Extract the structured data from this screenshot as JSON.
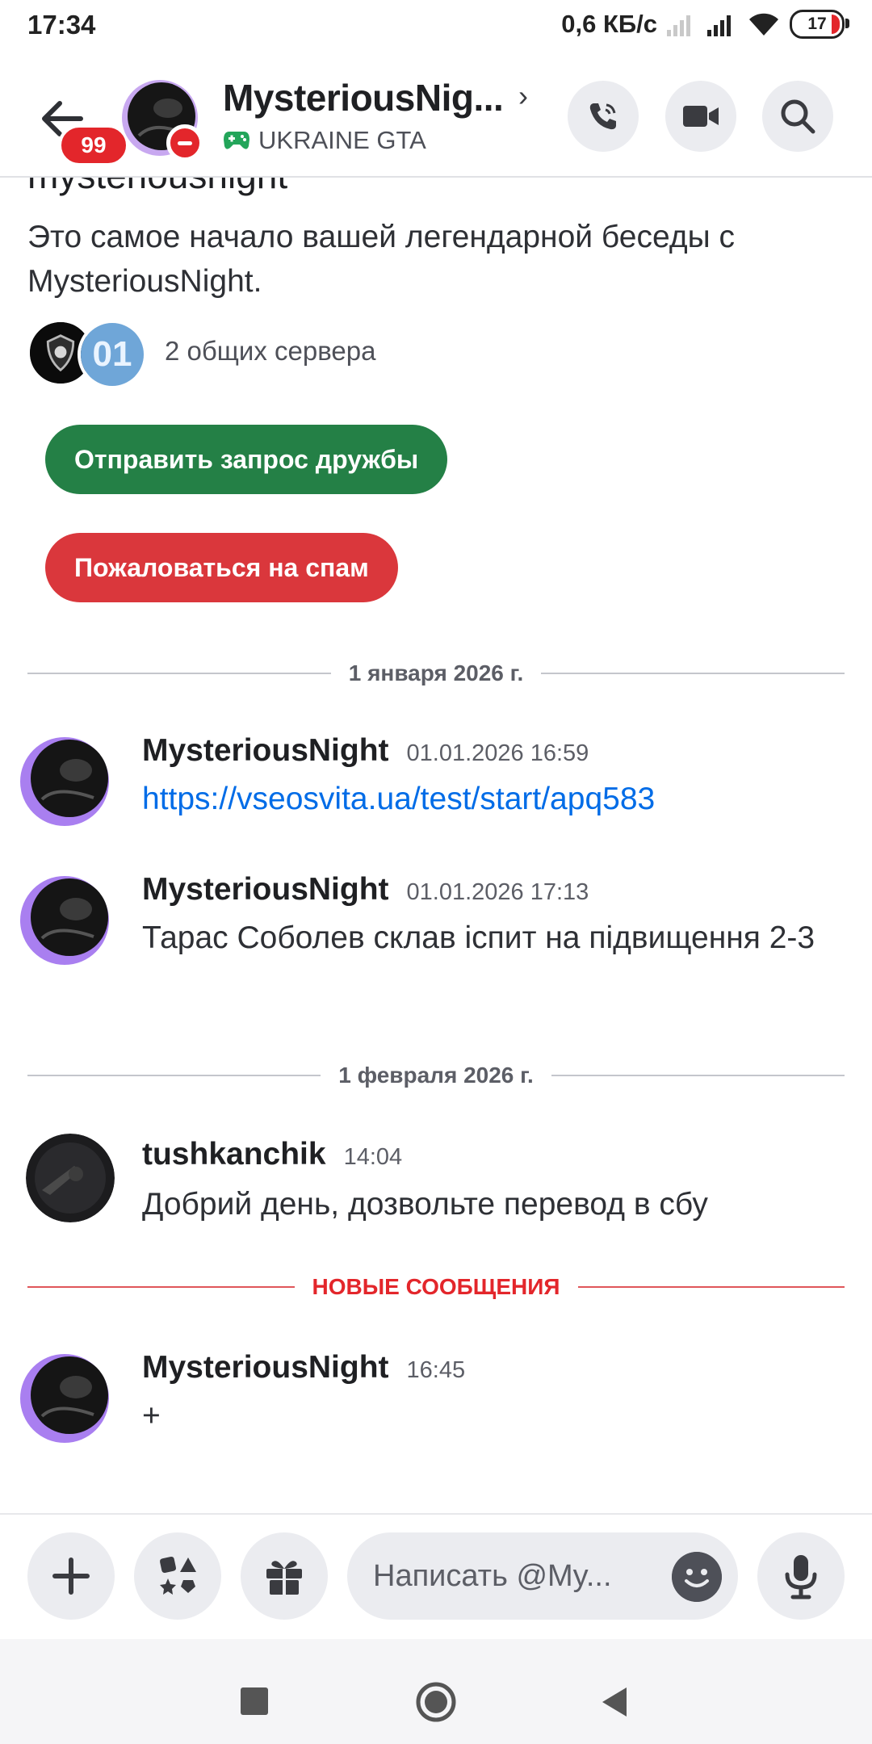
{
  "status_bar": {
    "time": "17:34",
    "speed": "0,6 КБ/с",
    "battery": "17"
  },
  "header": {
    "unread_badge": "99",
    "title": "MysteriousNig...",
    "activity": "UKRAINE GTA"
  },
  "intro": {
    "name_cut": "mysteriousnight",
    "text": "Это самое начало вашей легендарной беседы с MysteriousNight.",
    "mutual_servers": "2 общих сервера",
    "server_badge_text": "01",
    "friend_request": "Отправить запрос дружбы",
    "report_spam": "Пожаловаться на спам"
  },
  "dividers": {
    "jan": "1 января 2026 г.",
    "feb": "1 февраля 2026 г.",
    "new": "НОВЫЕ СООБЩЕНИЯ"
  },
  "messages": [
    {
      "author": "MysteriousNight",
      "time": "01.01.2026 16:59",
      "text": "https://vseosvita.ua/test/start/apq583"
    },
    {
      "author": "MysteriousNight",
      "time": "01.01.2026 17:13",
      "text": "Тарас Соболев склав іспит на підвищення 2-3"
    },
    {
      "author": "tushkanchik",
      "time": "14:04",
      "text": "Добрий день, дозвольте перевод в сбу"
    },
    {
      "author": "MysteriousNight",
      "time": "16:45",
      "text": "+"
    }
  ],
  "composer": {
    "placeholder": "Написать @My..."
  },
  "colors": {
    "accent_green": "#248046",
    "danger_red": "#da373c",
    "link_blue": "#006ce7"
  }
}
